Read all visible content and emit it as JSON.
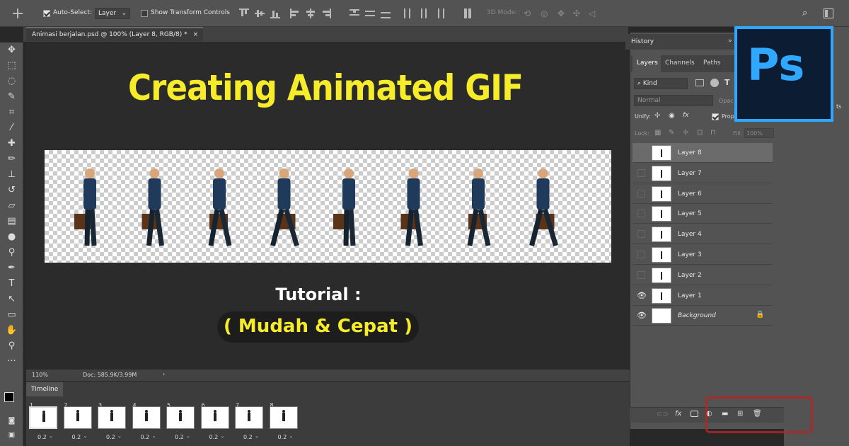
{
  "options_bar": {
    "auto_select_label": "Auto-Select:",
    "auto_select_value": "Layer",
    "show_transform_label": "Show Transform Controls",
    "mode_3d_label": "3D Mode:"
  },
  "document": {
    "tab_title": "Animasi berjalan.psd @ 100% (Layer 8, RGB/8) *",
    "zoom": "110%",
    "doc_size": "Doc: 585.9K/3.99M"
  },
  "artwork": {
    "title": "Creating Animated GIF",
    "tutorial_label": "Tutorial :",
    "subtitle": "( Mudah & Cepat )",
    "walker_frames": 8
  },
  "timeline": {
    "label": "Timeline",
    "frames": [
      {
        "num": "1",
        "delay": "0.2"
      },
      {
        "num": "2",
        "delay": "0.2"
      },
      {
        "num": "3",
        "delay": "0.2"
      },
      {
        "num": "4",
        "delay": "0.2"
      },
      {
        "num": "5",
        "delay": "0.2"
      },
      {
        "num": "6",
        "delay": "0.2"
      },
      {
        "num": "7",
        "delay": "0.2"
      },
      {
        "num": "8",
        "delay": "0.2"
      }
    ]
  },
  "history": {
    "label": "History"
  },
  "layers_panel": {
    "tabs": [
      "Layers",
      "Channels",
      "Paths"
    ],
    "filter_kind": "Kind",
    "blend_mode": "Normal",
    "opacity_label": "Opac",
    "unify_label": "Unify:",
    "lock_label": "Lock:",
    "fill_label": "Fill:",
    "fill_value": "100%",
    "propagate_label": "Prop",
    "layers": [
      {
        "name": "Layer 8",
        "visible": false,
        "active": true
      },
      {
        "name": "Layer 7",
        "visible": false
      },
      {
        "name": "Layer 6",
        "visible": false
      },
      {
        "name": "Layer 5",
        "visible": false
      },
      {
        "name": "Layer 4",
        "visible": false
      },
      {
        "name": "Layer 3",
        "visible": false
      },
      {
        "name": "Layer 2",
        "visible": false
      },
      {
        "name": "Layer 1",
        "visible": true
      },
      {
        "name": "Background",
        "visible": true,
        "locked": true
      }
    ]
  },
  "logo": {
    "text": "Ps"
  },
  "colors": {
    "accent_yellow": "#f7ec2a",
    "ps_blue": "#31a8ff",
    "ps_bg": "#0b1c33"
  }
}
